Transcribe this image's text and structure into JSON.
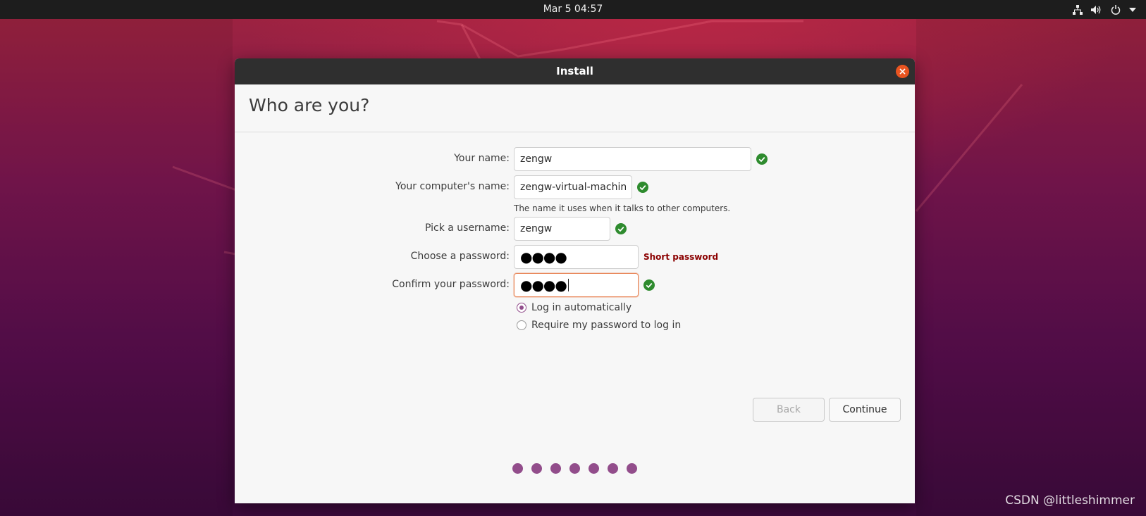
{
  "top_bar": {
    "datetime": "Mar 5  04:57",
    "tray_icons": [
      "network-icon",
      "volume-icon",
      "power-icon",
      "chevron-down-icon"
    ]
  },
  "window": {
    "title": "Install",
    "page_title": "Who are you?",
    "form": {
      "name_label": "Your name:",
      "name_value": "zengw",
      "computer_label": "Your computer's name:",
      "computer_value": "zengw-virtual-machine",
      "computer_hint": "The name it uses when it talks to other computers.",
      "username_label": "Pick a username:",
      "username_value": "zengw",
      "password_label": "Choose a password:",
      "password_mask": "●●●●",
      "password_strength": "Short password",
      "confirm_label": "Confirm your password:",
      "confirm_mask": "●●●●"
    },
    "login_options": [
      {
        "label": "Log in automatically",
        "selected": true
      },
      {
        "label": "Require my password to log in",
        "selected": false
      }
    ],
    "buttons": {
      "back": "Back",
      "continue": "Continue"
    },
    "progress_steps": 7
  },
  "colors": {
    "accent": "#924d8b",
    "close": "#e95420",
    "valid": "#2e8b2e",
    "warning": "#8b0000"
  },
  "watermark": "CSDN @littleshimmer"
}
